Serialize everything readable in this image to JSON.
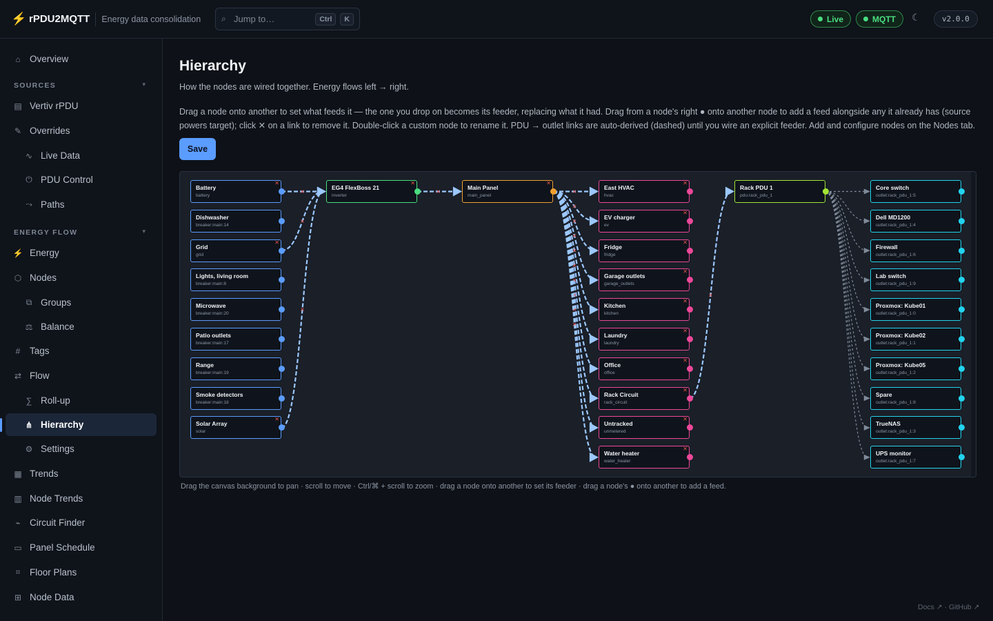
{
  "header": {
    "app_name": "rPDU2MQTT",
    "tagline": "Energy data consolidation",
    "search_placeholder": "Jump to…",
    "shortcut_mod": "Ctrl",
    "shortcut_key": "K",
    "live_label": "Live",
    "mqtt_label": "MQTT",
    "version": "v2.0.0"
  },
  "sidebar": {
    "overview": "Overview",
    "sources_title": "SOURCES",
    "vertiv": "Vertiv rPDU",
    "overrides": "Overrides",
    "live_data": "Live Data",
    "pdu_control": "PDU Control",
    "paths": "Paths",
    "energy_title": "ENERGY FLOW",
    "energy": "Energy",
    "nodes": "Nodes",
    "groups": "Groups",
    "balance": "Balance",
    "tags": "Tags",
    "flow": "Flow",
    "rollup": "Roll-up",
    "hierarchy": "Hierarchy",
    "settings": "Settings",
    "trends": "Trends",
    "node_trends": "Node Trends",
    "circuit_finder": "Circuit Finder",
    "panel_schedule": "Panel Schedule",
    "floor_plans": "Floor Plans",
    "node_data": "Node Data"
  },
  "page": {
    "title": "Hierarchy",
    "subtitle": "How the nodes are wired together. Energy flows left → right.",
    "help": "Drag a node onto another to set what feeds it — the one you drop on becomes its feeder, replacing what it had. Drag from a node's right ● onto another node to add a feed alongside any it already has (source powers target); click ✕ on a link to remove it. Double-click a custom node to rename it. PDU → outlet links are auto-derived (dashed) until you wire an explicit feeder. Add and configure nodes on the Nodes tab.",
    "save_label": "Save",
    "canvas_hint": "Drag the canvas background to pan · scroll to move · Ctrl/⌘ + scroll to zoom · drag a node onto another to set its feeder · drag a node's ● onto another to add a feed.",
    "footer": "Docs ↗ · GitHub ↗"
  },
  "colors": {
    "breaker": "#5b9cff",
    "source": "#5b9cff",
    "inverter": "#4ade80",
    "panel": "#f0a030",
    "load": "#ec4899",
    "pdu": "#a3e635",
    "outlet": "#22d3ee",
    "link": "#9cc8ff",
    "accent": "#5b9cff"
  },
  "graph": {
    "columns": [
      [
        {
          "name": "Battery",
          "id": "battery",
          "kind": "source",
          "removable": true
        },
        {
          "name": "Dishwasher",
          "id": "breaker:main:14",
          "kind": "breaker",
          "removable": false
        },
        {
          "name": "Grid",
          "id": "grid",
          "kind": "source",
          "removable": true
        },
        {
          "name": "Lights, living room",
          "id": "breaker:main:8",
          "kind": "breaker",
          "removable": false
        },
        {
          "name": "Microwave",
          "id": "breaker:main:20",
          "kind": "breaker",
          "removable": false
        },
        {
          "name": "Patio outlets",
          "id": "breaker:main:17",
          "kind": "breaker",
          "removable": false
        },
        {
          "name": "Range",
          "id": "breaker:main:19",
          "kind": "breaker",
          "removable": false
        },
        {
          "name": "Smoke detectors",
          "id": "breaker:main:18",
          "kind": "breaker",
          "removable": false
        },
        {
          "name": "Solar Array",
          "id": "solar",
          "kind": "source",
          "removable": true
        }
      ],
      [
        {
          "name": "EG4 FlexBoss 21",
          "id": "inverter",
          "kind": "inverter",
          "removable": true
        }
      ],
      [
        {
          "name": "Main Panel",
          "id": "main_panel",
          "kind": "panel",
          "removable": true
        }
      ],
      [
        {
          "name": "East HVAC",
          "id": "hvac",
          "kind": "load",
          "removable": true
        },
        {
          "name": "EV charger",
          "id": "ev",
          "kind": "load",
          "removable": true
        },
        {
          "name": "Fridge",
          "id": "fridge",
          "kind": "load",
          "removable": true
        },
        {
          "name": "Garage outlets",
          "id": "garage_outlets",
          "kind": "load",
          "removable": true
        },
        {
          "name": "Kitchen",
          "id": "kitchen",
          "kind": "load",
          "removable": true
        },
        {
          "name": "Laundry",
          "id": "laundry",
          "kind": "load",
          "removable": true
        },
        {
          "name": "Office",
          "id": "office",
          "kind": "load",
          "removable": true
        },
        {
          "name": "Rack Circuit",
          "id": "rack_circuit",
          "kind": "load",
          "removable": true
        },
        {
          "name": "Untracked",
          "id": "unmetered",
          "kind": "load",
          "removable": true
        },
        {
          "name": "Water heater",
          "id": "water_heater",
          "kind": "load",
          "removable": true
        }
      ],
      [
        {
          "name": "Rack PDU 1",
          "id": "pdu:rack_pdu_1",
          "kind": "pdu",
          "removable": false
        }
      ],
      [
        {
          "name": "Core switch",
          "id": "outlet:rack_pdu_1:5",
          "kind": "outlet",
          "removable": false
        },
        {
          "name": "Dell MD1200",
          "id": "outlet:rack_pdu_1:4",
          "kind": "outlet",
          "removable": false
        },
        {
          "name": "Firewall",
          "id": "outlet:rack_pdu_1:6",
          "kind": "outlet",
          "removable": false
        },
        {
          "name": "Lab switch",
          "id": "outlet:rack_pdu_1:9",
          "kind": "outlet",
          "removable": false
        },
        {
          "name": "Proxmox: Kube01",
          "id": "outlet:rack_pdu_1:0",
          "kind": "outlet",
          "removable": false
        },
        {
          "name": "Proxmox: Kube02",
          "id": "outlet:rack_pdu_1:1",
          "kind": "outlet",
          "removable": false
        },
        {
          "name": "Proxmox: Kube05",
          "id": "outlet:rack_pdu_1:2",
          "kind": "outlet",
          "removable": false
        },
        {
          "name": "Spare",
          "id": "outlet:rack_pdu_1:8",
          "kind": "outlet",
          "removable": false
        },
        {
          "name": "TrueNAS",
          "id": "outlet:rack_pdu_1:3",
          "kind": "outlet",
          "removable": false
        },
        {
          "name": "UPS monitor",
          "id": "outlet:rack_pdu_1:7",
          "kind": "outlet",
          "removable": false
        }
      ]
    ],
    "links": [
      {
        "from": [
          0,
          0
        ],
        "to": [
          1,
          0
        ],
        "style": "solid"
      },
      {
        "from": [
          0,
          2
        ],
        "to": [
          1,
          0
        ],
        "style": "solid"
      },
      {
        "from": [
          0,
          8
        ],
        "to": [
          1,
          0
        ],
        "style": "solid"
      },
      {
        "from": [
          1,
          0
        ],
        "to": [
          2,
          0
        ],
        "style": "solid"
      },
      {
        "from": [
          2,
          0
        ],
        "to": [
          3,
          0
        ],
        "style": "solid"
      },
      {
        "from": [
          2,
          0
        ],
        "to": [
          3,
          1
        ],
        "style": "solid"
      },
      {
        "from": [
          2,
          0
        ],
        "to": [
          3,
          2
        ],
        "style": "solid"
      },
      {
        "from": [
          2,
          0
        ],
        "to": [
          3,
          3
        ],
        "style": "solid"
      },
      {
        "from": [
          2,
          0
        ],
        "to": [
          3,
          4
        ],
        "style": "solid"
      },
      {
        "from": [
          2,
          0
        ],
        "to": [
          3,
          5
        ],
        "style": "solid"
      },
      {
        "from": [
          2,
          0
        ],
        "to": [
          3,
          6
        ],
        "style": "solid"
      },
      {
        "from": [
          2,
          0
        ],
        "to": [
          3,
          7
        ],
        "style": "solid"
      },
      {
        "from": [
          2,
          0
        ],
        "to": [
          3,
          8
        ],
        "style": "solid"
      },
      {
        "from": [
          2,
          0
        ],
        "to": [
          3,
          9
        ],
        "style": "solid"
      },
      {
        "from": [
          3,
          7
        ],
        "to": [
          4,
          0
        ],
        "style": "solid"
      },
      {
        "from": [
          4,
          0
        ],
        "to": [
          5,
          0
        ],
        "style": "auto"
      },
      {
        "from": [
          4,
          0
        ],
        "to": [
          5,
          1
        ],
        "style": "auto"
      },
      {
        "from": [
          4,
          0
        ],
        "to": [
          5,
          2
        ],
        "style": "auto"
      },
      {
        "from": [
          4,
          0
        ],
        "to": [
          5,
          3
        ],
        "style": "auto"
      },
      {
        "from": [
          4,
          0
        ],
        "to": [
          5,
          4
        ],
        "style": "auto"
      },
      {
        "from": [
          4,
          0
        ],
        "to": [
          5,
          5
        ],
        "style": "auto"
      },
      {
        "from": [
          4,
          0
        ],
        "to": [
          5,
          6
        ],
        "style": "auto"
      },
      {
        "from": [
          4,
          0
        ],
        "to": [
          5,
          7
        ],
        "style": "auto"
      },
      {
        "from": [
          4,
          0
        ],
        "to": [
          5,
          8
        ],
        "style": "auto"
      },
      {
        "from": [
          4,
          0
        ],
        "to": [
          5,
          9
        ],
        "style": "auto"
      }
    ]
  }
}
